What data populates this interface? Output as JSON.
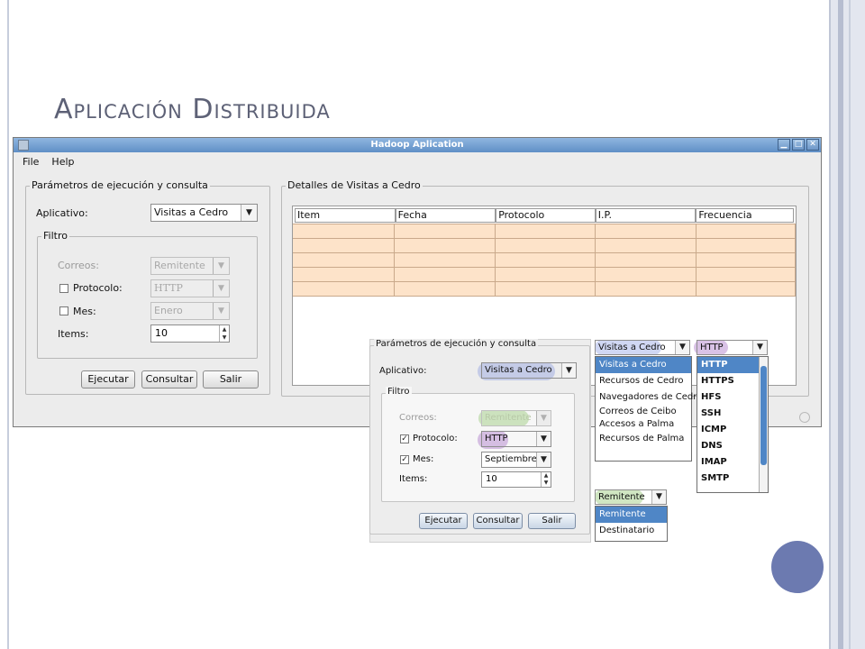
{
  "slide": {
    "title": "Aplicación Distribuida"
  },
  "window": {
    "title": "Hadoop Aplication",
    "controls": [
      "▁",
      "□",
      "✕"
    ]
  },
  "menu": {
    "file": "File",
    "help": "Help"
  },
  "params": {
    "legend": "Parámetros de ejecución y consulta",
    "aplicativo_label": "Aplicativo:",
    "aplicativo_value": "Visitas a Cedro",
    "filtro_legend": "Filtro",
    "correos_label": "Correos:",
    "correos_value": "Remitente",
    "protocolo_label": "Protocolo:",
    "protocolo_value": "HTTP",
    "mes_label": "Mes:",
    "mes_value": "Enero",
    "items_label": "Items:",
    "items_value": "10",
    "ejecutar": "Ejecutar",
    "consultar": "Consultar",
    "salir": "Salir"
  },
  "details": {
    "legend": "Detalles de Visitas a Cedro",
    "columns": [
      "Item",
      "Fecha",
      "Protocolo",
      "I.P.",
      "Frecuencia"
    ]
  },
  "overlay": {
    "legend": "Parámetros de ejecución y consulta",
    "aplicativo_label": "Aplicativo:",
    "aplicativo_value": "Visitas a Cedro",
    "filtro_legend": "Filtro",
    "correos_label": "Correos:",
    "correos_value": "Remitente",
    "protocolo_label": "Protocolo:",
    "protocolo_value": "HTTP",
    "mes_label": "Mes:",
    "mes_value": "Septiembre",
    "items_label": "Items:",
    "items_value": "10",
    "ejecutar": "Ejecutar",
    "consultar": "Consultar",
    "salir": "Salir"
  },
  "aplicativo_dropdown": {
    "value": "Visitas a Cedro",
    "options": [
      "Visitas a Cedro",
      "Recursos de Cedro",
      "Navegadores de Cedro",
      "Correos de Ceibo",
      "Accesos a Palma",
      "Recursos de Palma"
    ]
  },
  "protocolo_dropdown": {
    "value": "HTTP",
    "options": [
      "HTTP",
      "HTTPS",
      "HFS",
      "SSH",
      "ICMP",
      "DNS",
      "IMAP",
      "SMTP"
    ]
  },
  "correos_dropdown": {
    "value": "Remitente",
    "options": [
      "Remitente",
      "Destinatario"
    ]
  },
  "colors": {
    "titlebar": "#5f8fc6",
    "row_fill": "#fde3c9",
    "selection": "#4f86c6",
    "accent_circle": "#6c7ab0"
  }
}
